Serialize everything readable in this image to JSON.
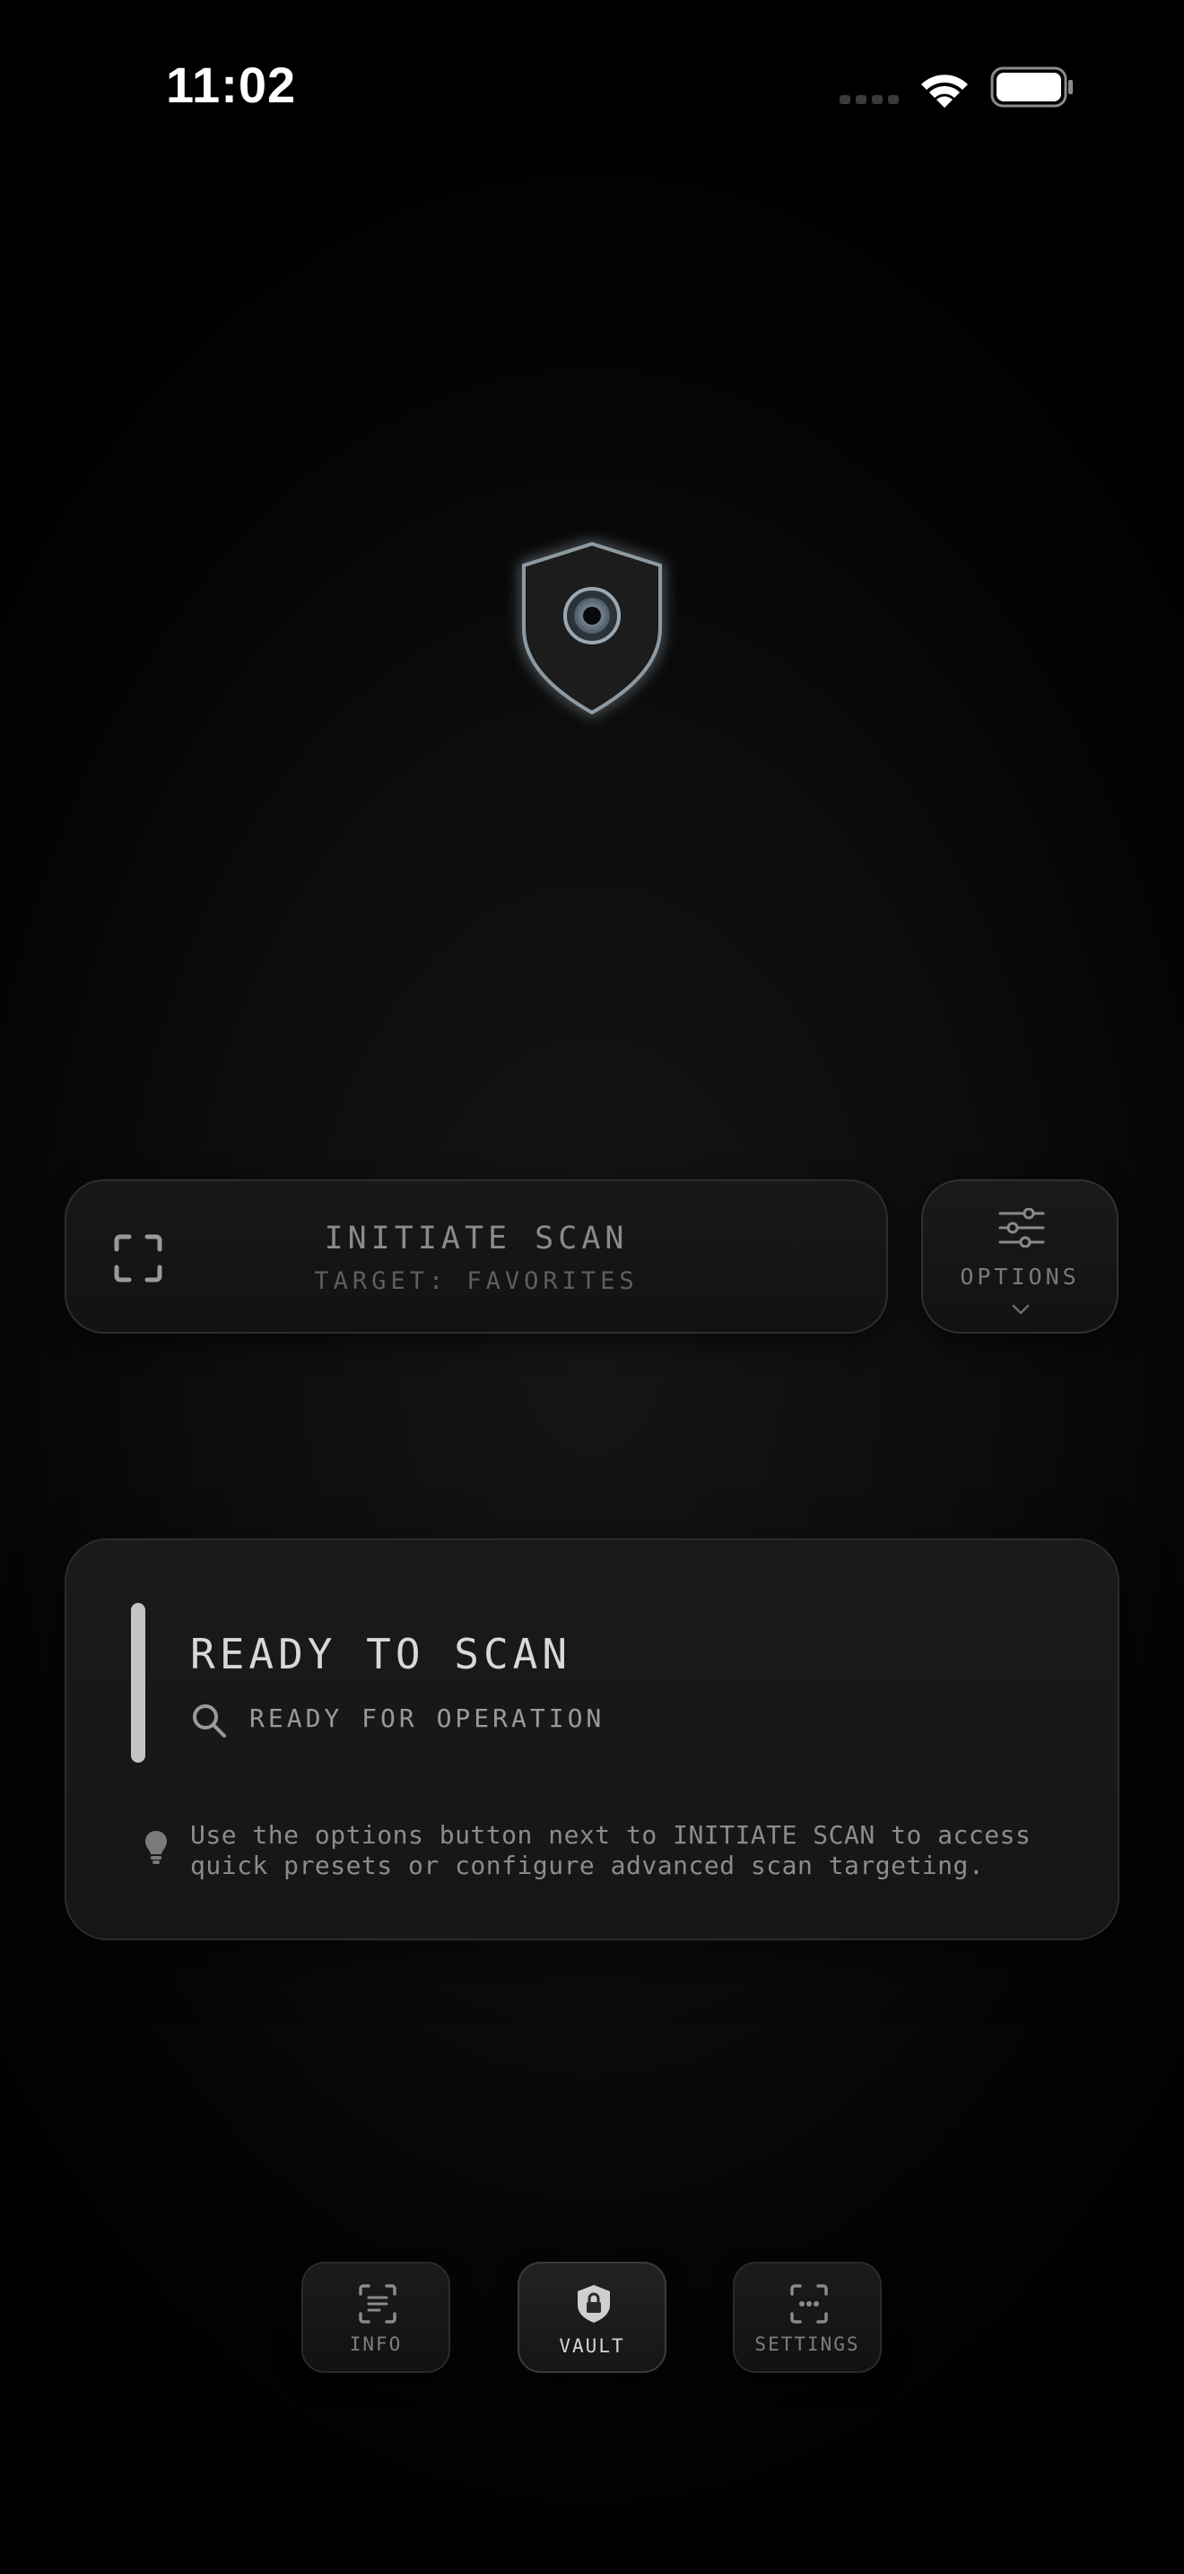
{
  "status_bar": {
    "time": "11:02"
  },
  "scan": {
    "title": "INITIATE SCAN",
    "subtitle": "TARGET: FAVORITES",
    "options_label": "OPTIONS"
  },
  "status_card": {
    "title": "READY TO SCAN",
    "subtitle": "READY FOR OPERATION",
    "hint": "Use the options button next to INITIATE SCAN to access\nquick presets or configure advanced scan targeting."
  },
  "nav": {
    "items": [
      {
        "label": "INFO",
        "icon": "document-scan-icon"
      },
      {
        "label": "VAULT",
        "icon": "shield-lock-icon"
      },
      {
        "label": "SETTINGS",
        "icon": "dots-frame-icon"
      }
    ],
    "active_index": 1
  },
  "colors": {
    "background": "#000000",
    "card": "#1a1a1a",
    "accent_bar": "#c4c4c4",
    "text_primary": "#d8d8d8",
    "text_muted": "#8a8a8a"
  }
}
